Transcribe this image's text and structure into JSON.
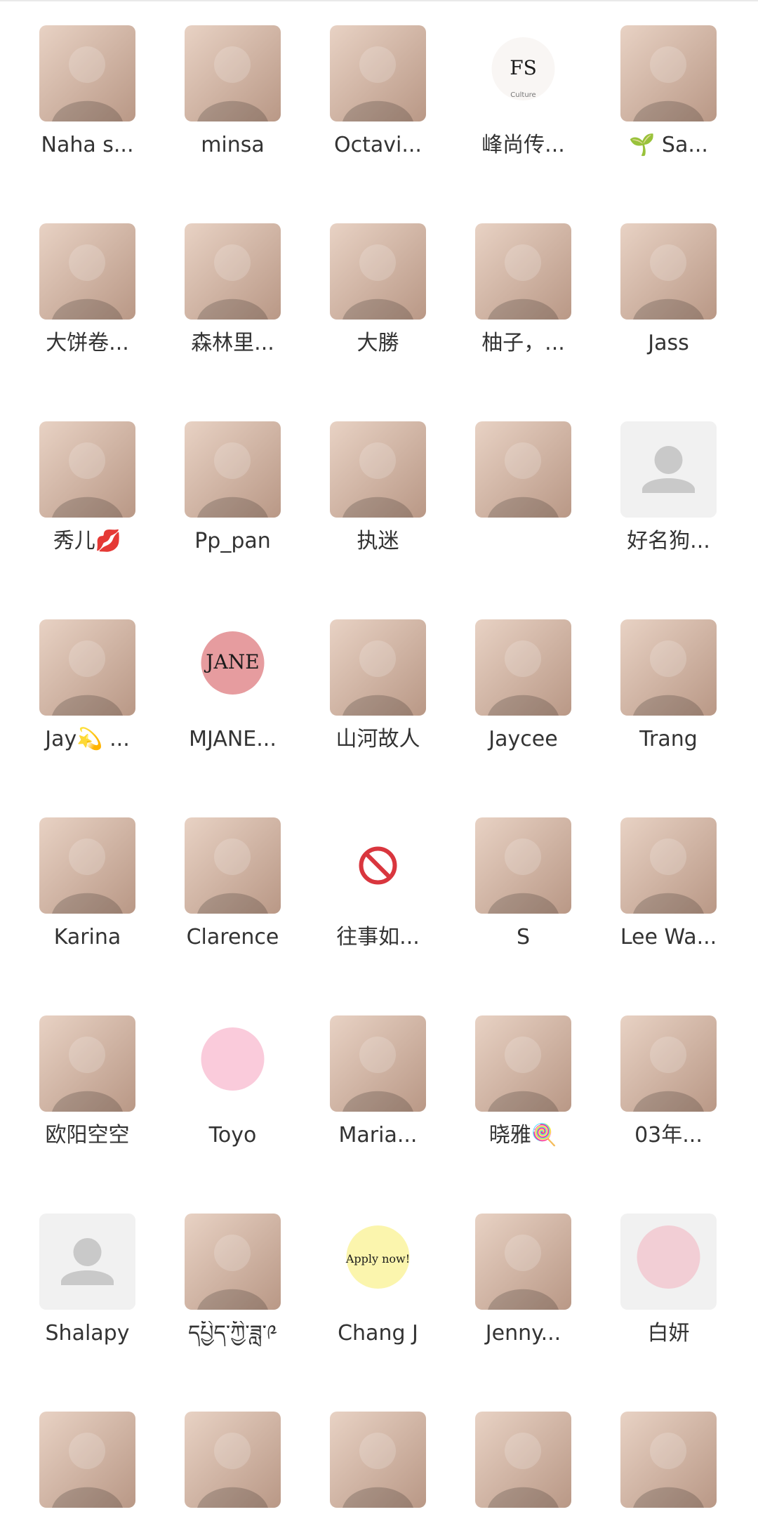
{
  "members": [
    {
      "name": "Naha s...",
      "avatar": {
        "type": "photo",
        "icon": "woman-blonde-selfie-icon",
        "c1": "#e8d2c4",
        "c2": "#b99886"
      }
    },
    {
      "name": "minsa",
      "avatar": {
        "type": "photo",
        "icon": "woman-portrait-icon",
        "c1": "#3a2a2a",
        "c2": "#c4a06a"
      }
    },
    {
      "name": "Octavi...",
      "avatar": {
        "type": "photo",
        "icon": "woman-lipstick-icon",
        "c1": "#c9b5ad",
        "c2": "#8a6a60"
      }
    },
    {
      "name": "峰尚传...",
      "avatar": {
        "type": "logo",
        "icon": "fs-culture-logo-icon",
        "logo_text": "FS",
        "logo_sub": "Culture",
        "c1": "#ffffff",
        "c2": "#f1ece6"
      }
    },
    {
      "name": "🌱 Sa...",
      "avatar": {
        "type": "photo",
        "icon": "lady-justice-icon",
        "c1": "#0f0f12",
        "c2": "#d4a83a"
      }
    },
    {
      "name": "大饼卷...",
      "avatar": {
        "type": "photo",
        "icon": "castle-icon",
        "c1": "#c9d3dc",
        "c2": "#8e7f70"
      }
    },
    {
      "name": "森林里...",
      "avatar": {
        "type": "photo",
        "icon": "heart-bear-poster-icon",
        "c1": "#b21e24",
        "c2": "#f1d08a"
      }
    },
    {
      "name": "大勝",
      "avatar": {
        "type": "photo",
        "icon": "golden-buddha-icon",
        "c1": "#7a4a1a",
        "c2": "#d9a640"
      }
    },
    {
      "name": "柚子，...",
      "avatar": {
        "type": "photo",
        "icon": "cake-icon",
        "c1": "#2a2522",
        "c2": "#efe6de"
      }
    },
    {
      "name": "Jass",
      "avatar": {
        "type": "photo",
        "icon": "blue-waves-icon",
        "c1": "#2f6df2",
        "c2": "#6fb0ff"
      }
    },
    {
      "name": "秀儿💋",
      "avatar": {
        "type": "photo",
        "icon": "woman-flowers-icon",
        "c1": "#1f6b4a",
        "c2": "#e6d3c4"
      }
    },
    {
      "name": "Pp_pan",
      "avatar": {
        "type": "photo",
        "icon": "house-icon",
        "c1": "#8fb1d8",
        "c2": "#6d8a4a"
      }
    },
    {
      "name": "执迷",
      "avatar": {
        "type": "photo",
        "icon": "pagoda-night-icon",
        "c1": "#0f1420",
        "c2": "#c79a4a"
      }
    },
    {
      "name": "",
      "avatar": {
        "type": "photo",
        "icon": "mountain-sunset-icon",
        "c1": "#ff8a1a",
        "c2": "#6a2f0a"
      }
    },
    {
      "name": "好名狗...",
      "avatar": {
        "type": "placeholder",
        "icon": "default-user-icon",
        "c1": "#f1f1f1",
        "c2": "#c9c9c9"
      }
    },
    {
      "name": "Jay💫 ...",
      "avatar": {
        "type": "photo",
        "icon": "man-santa-hat-icon",
        "c1": "#e9e4dc",
        "c2": "#2a2a2a"
      }
    },
    {
      "name": "MJANE...",
      "avatar": {
        "type": "logo",
        "icon": "mjane-heart-logo-icon",
        "logo_text": "JANE",
        "logo_sub": "",
        "c1": "#ffffff",
        "c2": "#c7242b"
      }
    },
    {
      "name": "山河故人",
      "avatar": {
        "type": "photo",
        "icon": "man-portrait-icon",
        "c1": "#3a7fd0",
        "c2": "#d9b8a0"
      }
    },
    {
      "name": "Jaycee",
      "avatar": {
        "type": "photo",
        "icon": "dark-corridor-icon",
        "c1": "#1a1715",
        "c2": "#d8c3a8"
      }
    },
    {
      "name": "Trang",
      "avatar": {
        "type": "photo",
        "icon": "woman-veil-icon",
        "c1": "#4a6a40",
        "c2": "#f1e6f6"
      }
    },
    {
      "name": "Karina",
      "avatar": {
        "type": "photo",
        "icon": "woman-room-icon",
        "c1": "#e8e4df",
        "c2": "#2b2b2b"
      }
    },
    {
      "name": "Clarence",
      "avatar": {
        "type": "photo",
        "icon": "sunset-painting-icon",
        "c1": "#f08a2a",
        "c2": "#2a1a30"
      }
    },
    {
      "name": "往事如...",
      "avatar": {
        "type": "prohibited",
        "icon": "prohibited-icon",
        "c1": "#ffffff",
        "c2": "#d9363e"
      }
    },
    {
      "name": "S",
      "avatar": {
        "type": "photo",
        "icon": "woman-field-icon",
        "c1": "#6a9ad6",
        "c2": "#6a7a3a"
      }
    },
    {
      "name": "Lee Wa...",
      "avatar": {
        "type": "photo",
        "icon": "woman-scarf-icon",
        "c1": "#d8d8d8",
        "c2": "#1a1a1a"
      }
    },
    {
      "name": "欧阳空空",
      "avatar": {
        "type": "photo",
        "icon": "boy-portrait-icon",
        "c1": "#d9c9a8",
        "c2": "#7a5a3a"
      }
    },
    {
      "name": "Toyo",
      "avatar": {
        "type": "logo",
        "icon": "hello-kitty-icon",
        "logo_text": "",
        "logo_sub": "",
        "c1": "#ffffff",
        "c2": "#f58bb0"
      }
    },
    {
      "name": "Maria...",
      "avatar": {
        "type": "photo",
        "icon": "woman-dark-portrait-icon",
        "c1": "#d8d3cf",
        "c2": "#1e1e1e"
      }
    },
    {
      "name": "晓雅🍭",
      "avatar": {
        "type": "photo",
        "icon": "woman-car-icon",
        "c1": "#dfe3e8",
        "c2": "#f2e4a8"
      }
    },
    {
      "name": "03年...",
      "avatar": {
        "type": "photo",
        "icon": "woman-smile-icon",
        "c1": "#c05a3a",
        "c2": "#f2d6c8"
      }
    },
    {
      "name": "Shalapy",
      "avatar": {
        "type": "placeholder",
        "icon": "default-user-icon",
        "c1": "#f1f1f1",
        "c2": "#c9c9c9"
      }
    },
    {
      "name": "དཔྱིད་ཀྱི་ཟླ་༩",
      "avatar": {
        "type": "photo",
        "icon": "tibetan-thangka-icon",
        "c1": "#2a6a5a",
        "c2": "#c83a2a"
      }
    },
    {
      "name": "Chang J",
      "avatar": {
        "type": "logo",
        "icon": "apply-now-note-icon",
        "logo_text": "Apply now!",
        "logo_sub": "",
        "c1": "#ffffff",
        "c2": "#f6e94a"
      }
    },
    {
      "name": "Jenny...",
      "avatar": {
        "type": "photo",
        "icon": "motorcycle-icon",
        "c1": "#3a7ad6",
        "c2": "#1a1a1a"
      }
    },
    {
      "name": "白妍",
      "avatar": {
        "type": "logo",
        "icon": "cartoon-girl-icon",
        "logo_text": "",
        "logo_sub": "",
        "c1": "#f1f1f1",
        "c2": "#f5a4b3"
      }
    },
    {
      "name": "",
      "avatar": {
        "type": "photo",
        "icon": "cat-yawning-icon",
        "c1": "#d9d2cc",
        "c2": "#f5efe9"
      }
    },
    {
      "name": "",
      "avatar": {
        "type": "photo",
        "icon": "woman-headphones-icon",
        "c1": "#2a2a2a",
        "c2": "#f2e0dc"
      }
    },
    {
      "name": "",
      "avatar": {
        "type": "photo",
        "icon": "illustrated-girl-icon",
        "c1": "#ffffff",
        "c2": "#7a4a2a"
      }
    },
    {
      "name": "",
      "avatar": {
        "type": "photo",
        "icon": "man-trees-icon",
        "c1": "#2a6a2a",
        "c2": "#d98a7a"
      }
    },
    {
      "name": "",
      "avatar": {
        "type": "photo",
        "icon": "woman-portrait-icon",
        "c1": "#efe7e2",
        "c2": "#d3b2a8"
      }
    }
  ]
}
